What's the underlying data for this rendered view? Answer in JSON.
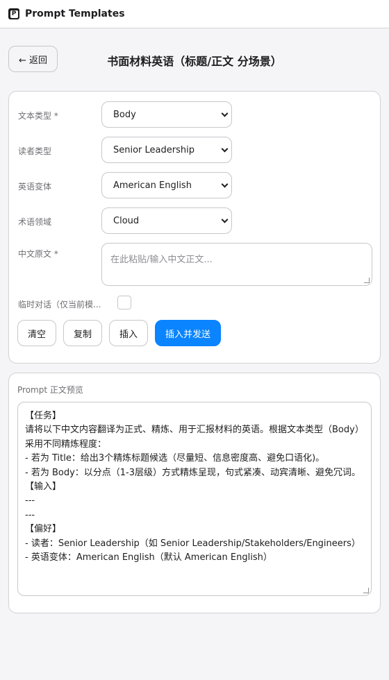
{
  "app": {
    "title": "Prompt Templates",
    "logo_letter": "P"
  },
  "header": {
    "back_label": "← 返回",
    "page_title": "书面材料英语（标题/正文 分场景）"
  },
  "form": {
    "text_type": {
      "label": "文本类型 *",
      "value": "Body"
    },
    "reader_type": {
      "label": "读者类型",
      "value": "Senior Leadership"
    },
    "english_variant": {
      "label": "英语变体",
      "value": "American English"
    },
    "term_domain": {
      "label": "术语领域",
      "value": "Cloud"
    },
    "chinese_source": {
      "label": "中文原文 *",
      "placeholder": "在此粘贴/输入中文正文..."
    },
    "temp_chat": {
      "label": "临时对话（仅当前模...",
      "checked": false
    },
    "buttons": {
      "clear": "清空",
      "copy": "复制",
      "insert": "插入",
      "insert_send": "插入并发送"
    }
  },
  "preview": {
    "label": "Prompt 正文预览",
    "lines": [
      "【任务】",
      "请将以下中文内容翻译为正式、精炼、用于汇报材料的英语。根据文本类型（Body）",
      "采用不同精炼程度：",
      "- 若为 Title：给出3个精炼标题候选（尽量短、信息密度高、避免口语化)。",
      "- 若为 Body：以分点（1-3层级）方式精炼呈现，句式紧凑、动宾清晰、避免冗词。",
      "",
      "【输入】",
      "---",
      "",
      "---",
      "",
      "【偏好】",
      "- 读者：Senior Leadership（如 Senior Leadership/Stakeholders/Engineers）",
      "- 英语变体：American English（默认 American English）"
    ]
  },
  "colors": {
    "accent": "#0a84ff",
    "border": "#c7c7cc",
    "background": "#f5f5f7"
  }
}
